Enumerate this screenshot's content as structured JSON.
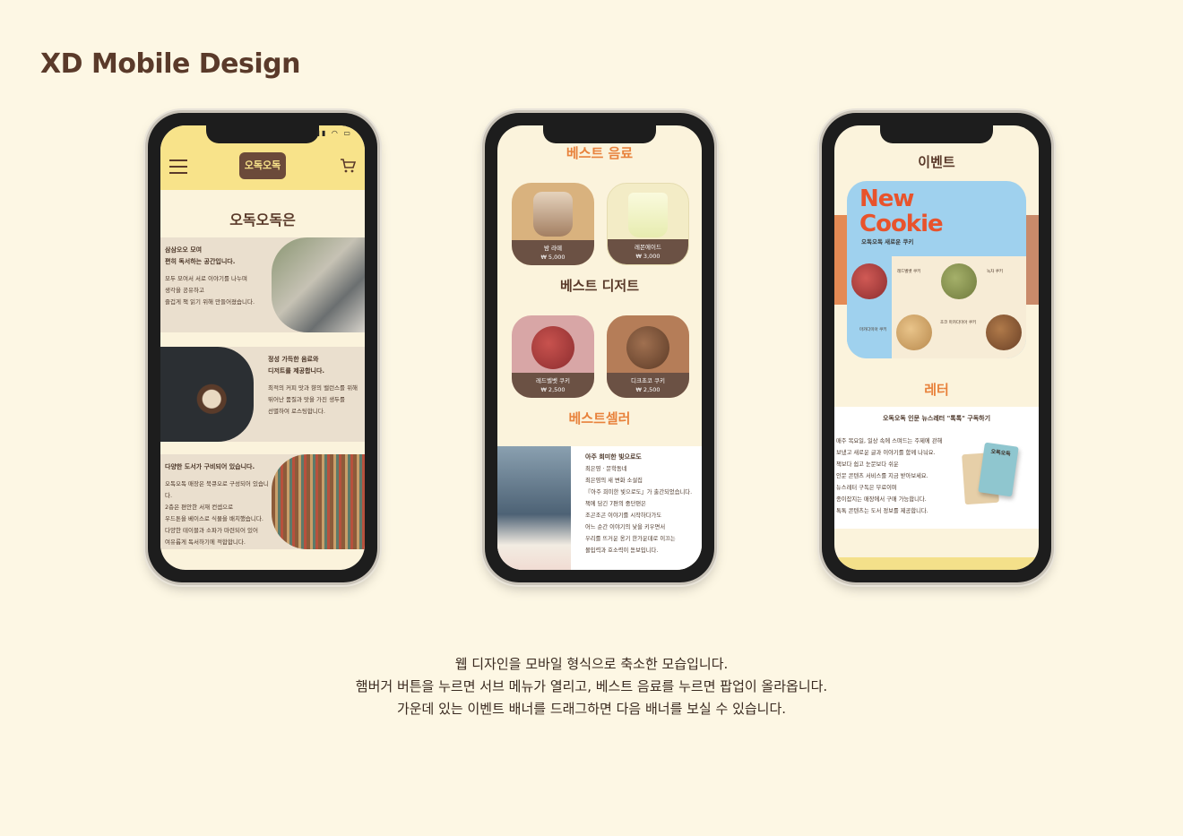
{
  "page_title": "XD Mobile Design",
  "phone1": {
    "logo": "오독오독",
    "heading": "오독오독은",
    "cards": [
      {
        "title": "삼삼오오 모여\n편히 독서하는 공간입니다.",
        "body": "모두 모여서 서로 이야기를 나누며\n생각을 공유하고\n즐겁게 책 읽기 위해 만들어졌습니다."
      },
      {
        "title": "정성 가득한 음료와\n디저트를 제공합니다.",
        "body": "최적의 커피 맛과 향의 밸런스를 위해\n뛰어난 품질과 맛을 가진 생두를\n선별하여 로스팅합니다."
      },
      {
        "title": "다양한 도서가 구비되어 있습니다.",
        "body": "오독오독 매장은 북큐오로 구성되어 있습니다.\n2층은 편안한 서재 컨셉으로\n우드톤을 베이스로 식물을 배치했습니다.\n다양한 테이블과 소파가 마련되어 있어\n여유롭게 독서하기에 적합합니다."
      }
    ]
  },
  "phone2": {
    "best_drinks": "베스트 음료",
    "best_desserts": "베스트 디저트",
    "best_seller": "베스트셀러",
    "drinks": [
      {
        "name": "밤 라떼",
        "price": "₩ 5,000"
      },
      {
        "name": "레몬에이드",
        "price": "₩ 3,000"
      }
    ],
    "desserts": [
      {
        "name": "레드벨벳 쿠키",
        "price": "₩ 2,500"
      },
      {
        "name": "디크초코 쿠키",
        "price": "₩ 2,500"
      }
    ],
    "book": {
      "title": "아주 희미한 빛으로도",
      "author": "최은영 · 문학동네",
      "desc": "최은영의 새 변화 소설집\n『아주 희미한 빛으로도』가 출간되었습니다.\n책에 담긴 7편의 중단편은\n조곤조곤 이야기를 시작하다가도\n어느 순간 이야기의 낯을 키우면서\n우리를 뜨거운 옹기 한가운데로 이끄는\n몰입력과 호소력이 돋보입니다."
    }
  },
  "phone3": {
    "event_title": "이벤트",
    "banner_title": "New\nCookie",
    "banner_sub": "오독오독 새로운 쿠키",
    "cookies": [
      "레드벨벳 쿠키",
      "녹차 쿠키",
      "초코 마카다미아 쿠키",
      "마카다미아 쿠키"
    ],
    "letter_title": "레터",
    "letter_heading": "오독오독 인문 뉴스레터 \"톡톡\" 구독하기",
    "letter_body": "매주 목요일, 일상 속에 스며드는 주제에 관해\n보냈고 새로운 글과 이야기를 함께 나눠요.\n책보다 쉽고 눈문보다 쉬운\n인문 콘텐츠 서비스를 지금 받아보세요.\n뉴스레터 구독은 무료이며\n종이잡지는 매장에서 구매 가능합니다.\n톡톡 콘텐츠는 도서 정보를 제공합니다.",
    "magazine_logo": "오독오독"
  },
  "caption": {
    "line1": "웹 디자인을 모바일 형식으로 축소한 모습입니다.",
    "line2": "햄버거 버튼을 누르면 서브 메뉴가 열리고, 베스트 음료를 누르면 팝업이 올라옵니다.",
    "line3": "가운데 있는 이벤트 배너를 드래그하면 다음 배너를 보실 수 있습니다."
  },
  "colors": {
    "background": "#fdf7e4",
    "header_yellow": "#f8e38a",
    "accent_orange": "#e8823c",
    "brown": "#5a3a2a",
    "card_beige": "#eadfce",
    "label_brown": "#6b5144",
    "banner_blue": "#9fd1ee"
  }
}
